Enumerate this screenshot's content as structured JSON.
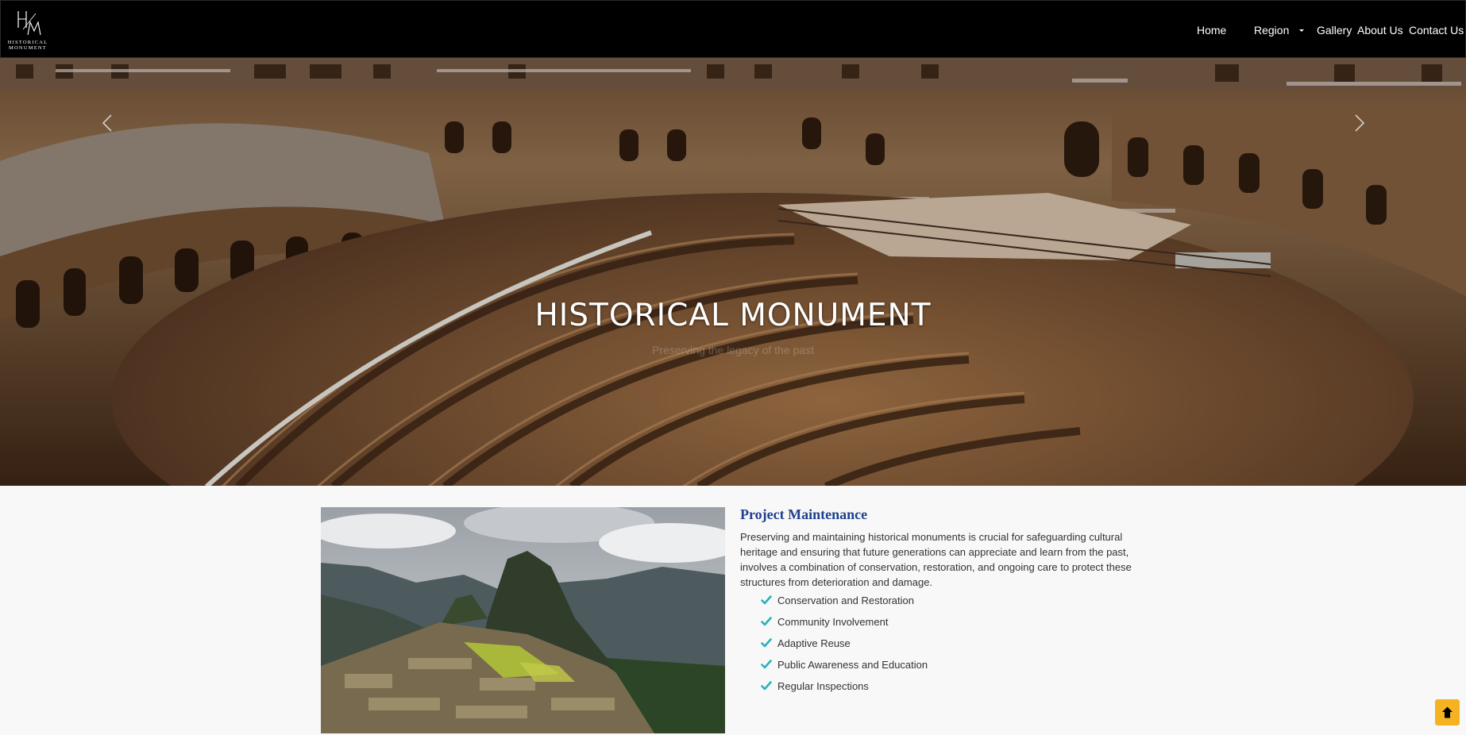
{
  "logo": {
    "monogram": "HM",
    "line1": "HISTORICAL",
    "line2": "MONUMENT"
  },
  "nav": {
    "home": "Home",
    "region": "Region",
    "gallery": "Gallery",
    "about": "About Us",
    "contact": "Contact Us"
  },
  "hero": {
    "title": "HISTORICAL MONUMENT",
    "subtitle": "Preserving the legacy of the past"
  },
  "section": {
    "title": "Project Maintenance",
    "paragraph": "Preserving and maintaining historical monuments is crucial for safeguarding cultural heritage and ensuring that future generations can appreciate and learn from the past, involves a combination of conservation, restoration, and ongoing care to protect these structures from deterioration and damage.",
    "features": [
      "Conservation and Restoration",
      "Community Involvement",
      "Adaptive Reuse",
      "Public Awareness and Education",
      "Regular Inspections"
    ]
  },
  "colors": {
    "nav_bg": "#000000",
    "title_blue": "#1f3f8f",
    "check_teal": "#27b3b7",
    "back_to_top": "#f5b324"
  },
  "icons": {
    "prev": "chevron-left-icon",
    "next": "chevron-right-icon",
    "check": "check-icon",
    "back_to_top": "arrow-up-icon",
    "dropdown": "caret-down-icon"
  }
}
